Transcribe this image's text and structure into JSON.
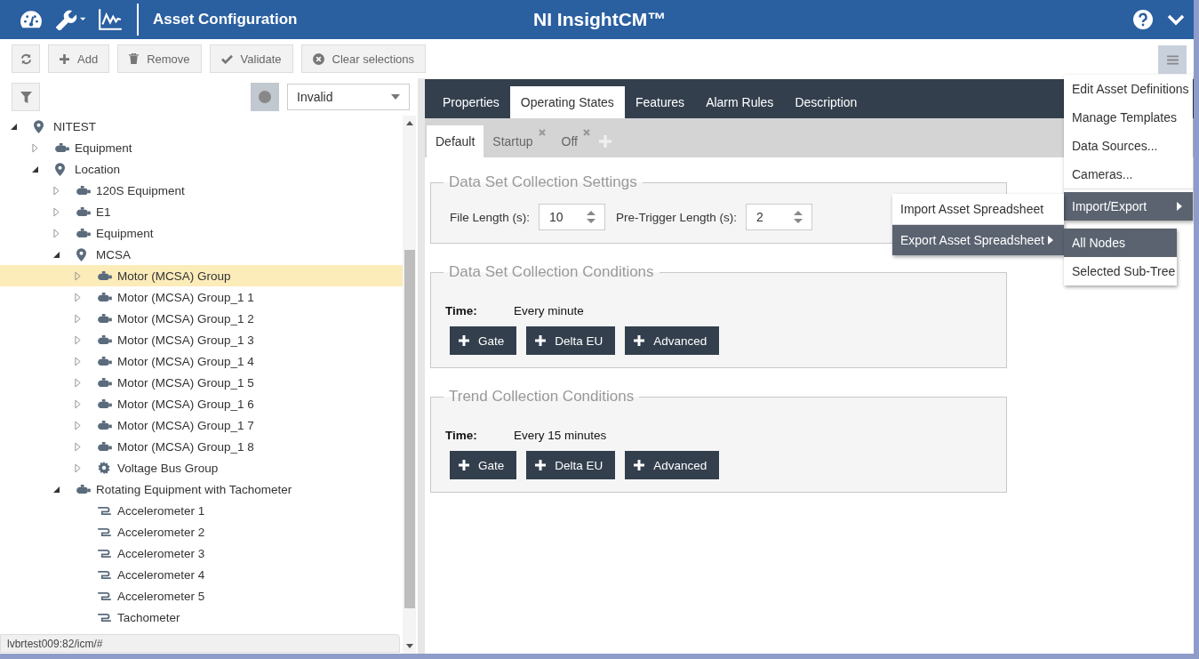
{
  "header": {
    "title": "Asset Configuration",
    "brand": "NI InsightCM™"
  },
  "toolbar": [
    {
      "kind": "refresh"
    },
    {
      "kind": "add",
      "label": "Add"
    },
    {
      "kind": "remove",
      "label": "Remove"
    },
    {
      "kind": "validate",
      "label": "Validate"
    },
    {
      "kind": "clear",
      "label": "Clear selections"
    }
  ],
  "filter": {
    "status": "Invalid"
  },
  "tree": [
    {
      "label": "NITEST",
      "kind": "location",
      "expanded": true,
      "selected": false,
      "children": [
        {
          "label": "Equipment",
          "kind": "equipment",
          "expanded": false,
          "selected": false
        },
        {
          "label": "Location",
          "kind": "location",
          "expanded": true,
          "selected": false,
          "children": [
            {
              "label": "120S Equipment",
              "kind": "equipment",
              "expanded": false,
              "selected": false
            },
            {
              "label": "E1",
              "kind": "equipment",
              "expanded": false,
              "selected": false
            },
            {
              "label": "Equipment",
              "kind": "equipment",
              "expanded": false,
              "selected": false
            },
            {
              "label": "MCSA",
              "kind": "location",
              "expanded": true,
              "selected": false,
              "children": [
                {
                  "label": "Motor (MCSA) Group",
                  "kind": "equipment",
                  "expanded": false,
                  "selected": true
                },
                {
                  "label": "Motor (MCSA) Group_1 1",
                  "kind": "equipment",
                  "expanded": false,
                  "selected": false
                },
                {
                  "label": "Motor (MCSA) Group_1 2",
                  "kind": "equipment",
                  "expanded": false,
                  "selected": false
                },
                {
                  "label": "Motor (MCSA) Group_1 3",
                  "kind": "equipment",
                  "expanded": false,
                  "selected": false
                },
                {
                  "label": "Motor (MCSA) Group_1 4",
                  "kind": "equipment",
                  "expanded": false,
                  "selected": false
                },
                {
                  "label": "Motor (MCSA) Group_1 5",
                  "kind": "equipment",
                  "expanded": false,
                  "selected": false
                },
                {
                  "label": "Motor (MCSA) Group_1 6",
                  "kind": "equipment",
                  "expanded": false,
                  "selected": false
                },
                {
                  "label": "Motor (MCSA) Group_1 7",
                  "kind": "equipment",
                  "expanded": false,
                  "selected": false
                },
                {
                  "label": "Motor (MCSA) Group_1 8",
                  "kind": "equipment",
                  "expanded": false,
                  "selected": false
                },
                {
                  "label": "Voltage Bus Group",
                  "kind": "group",
                  "expanded": false,
                  "selected": false
                }
              ]
            },
            {
              "label": "Rotating Equipment with Tachometer",
              "kind": "equipment",
              "expanded": true,
              "selected": false,
              "children": [
                {
                  "label": "Accelerometer 1",
                  "kind": "sensor",
                  "selected": false
                },
                {
                  "label": "Accelerometer 2",
                  "kind": "sensor",
                  "selected": false
                },
                {
                  "label": "Accelerometer 3",
                  "kind": "sensor",
                  "selected": false
                },
                {
                  "label": "Accelerometer 4",
                  "kind": "sensor",
                  "selected": false
                },
                {
                  "label": "Accelerometer 5",
                  "kind": "sensor",
                  "selected": false
                },
                {
                  "label": "Tachometer",
                  "kind": "sensor",
                  "selected": false
                }
              ]
            }
          ]
        }
      ]
    }
  ],
  "status_url": "lvbrtest009:82/icm/#",
  "tabs": [
    {
      "label": "Properties",
      "selected": false
    },
    {
      "label": "Operating States",
      "selected": true
    },
    {
      "label": "Features",
      "selected": false
    },
    {
      "label": "Alarm Rules",
      "selected": false
    },
    {
      "label": "Description",
      "selected": false
    }
  ],
  "state_tabs": [
    {
      "label": "Default",
      "selected": true,
      "closable": false
    },
    {
      "label": "Startup",
      "selected": false,
      "closable": true
    },
    {
      "label": "Off",
      "selected": false,
      "closable": true
    }
  ],
  "sections": [
    {
      "kind": "settings",
      "title": "Data Set Collection Settings",
      "fields": [
        {
          "label": "File Length (s):",
          "value": "10"
        },
        {
          "label": "Pre-Trigger Length (s):",
          "value": "2"
        }
      ]
    },
    {
      "kind": "conditions",
      "title": "Data Set Collection Conditions",
      "time_label": "Time:",
      "time_value": "Every minute",
      "buttons": [
        "Gate",
        "Delta EU",
        "Advanced"
      ]
    },
    {
      "kind": "conditions",
      "title": "Trend Collection Conditions",
      "time_label": "Time:",
      "time_value": "Every 15 minutes",
      "buttons": [
        "Gate",
        "Delta EU",
        "Advanced"
      ]
    }
  ],
  "menu": [
    {
      "label": "Edit Asset Definitions",
      "selected": false
    },
    {
      "label": "Manage Templates",
      "selected": false
    },
    {
      "label": "Data Sources...",
      "selected": false
    },
    {
      "label": "Cameras...",
      "selected": false
    },
    {
      "label": "Import/Export",
      "selected": true,
      "children": [
        {
          "label": "Import Asset Spreadsheet",
          "selected": false
        },
        {
          "label": "Export Asset Spreadsheet",
          "selected": true,
          "children": [
            {
              "label": "All Nodes",
              "selected": true
            },
            {
              "label": "Selected Sub-Tree",
              "selected": false
            }
          ]
        }
      ]
    }
  ]
}
